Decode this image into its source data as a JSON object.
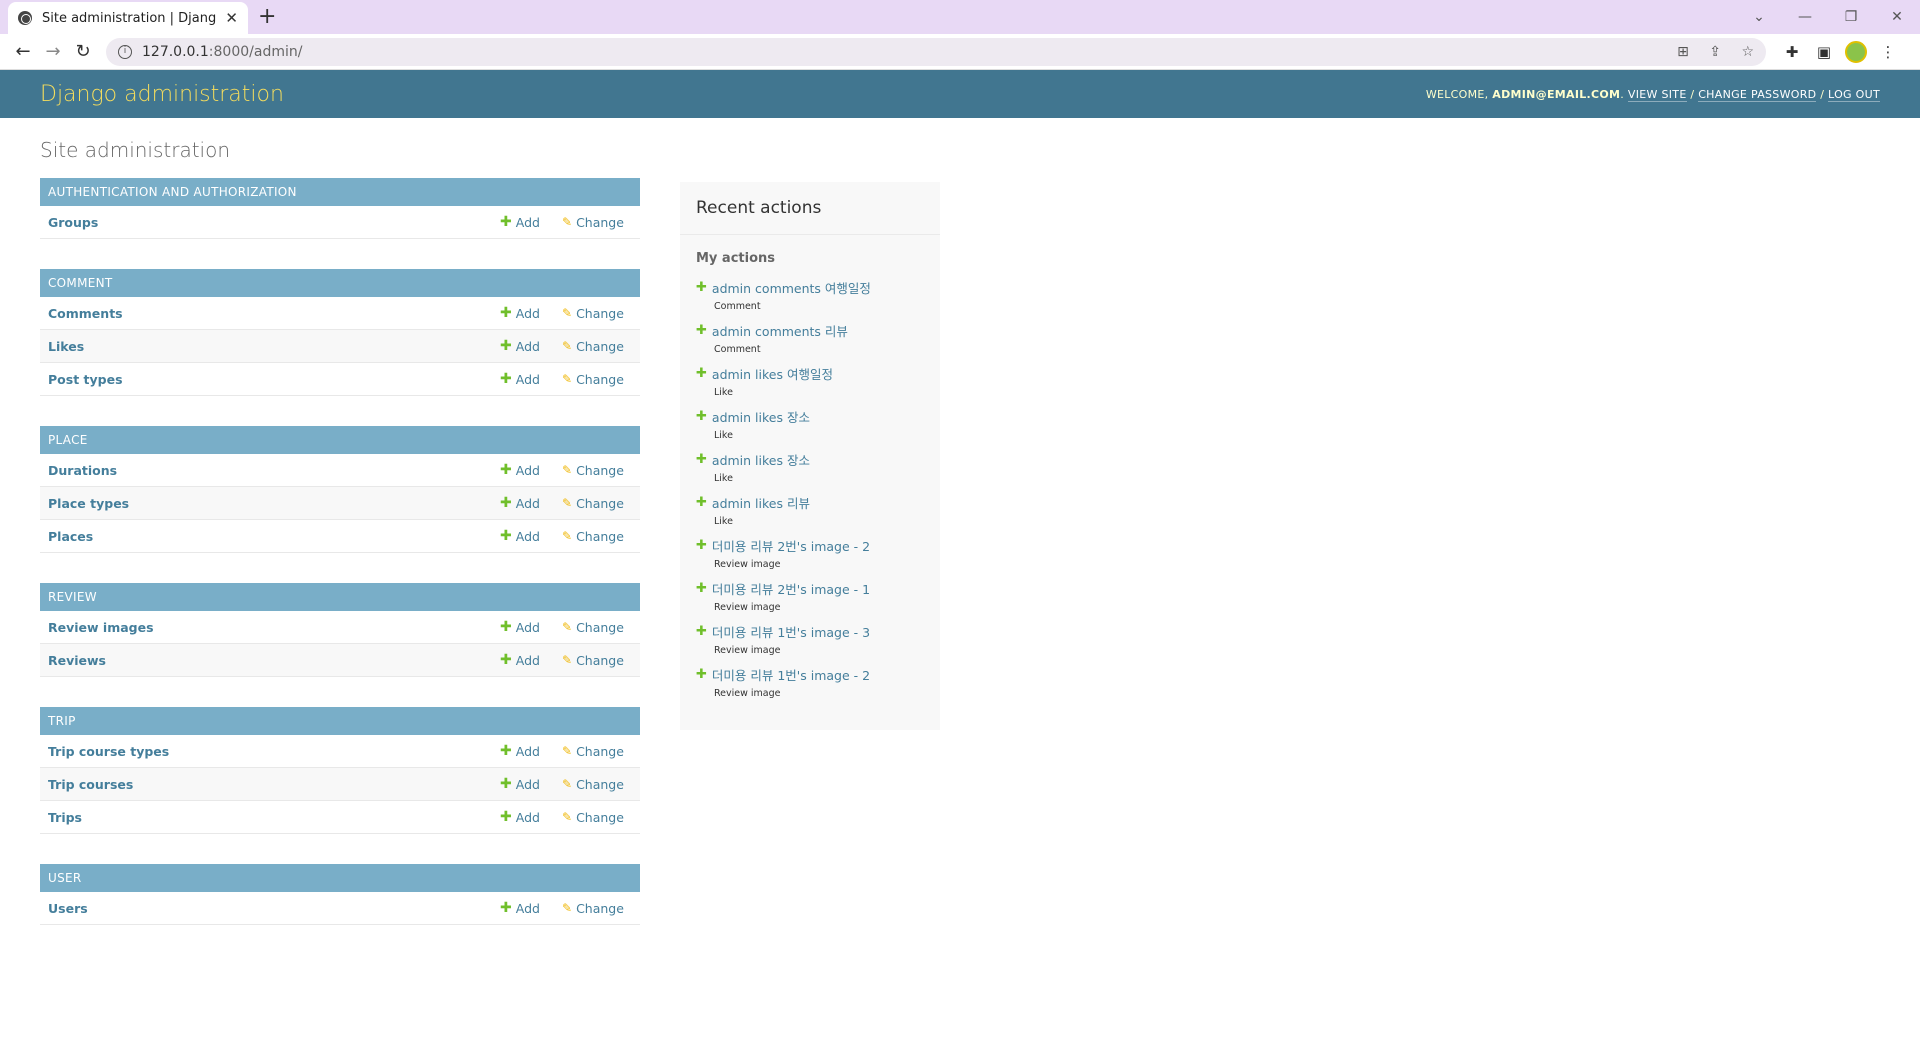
{
  "browser": {
    "tab_title": "Site administration | Django site admin",
    "url_host": "127.0.0.1",
    "url_rest": ":8000/admin/"
  },
  "header": {
    "branding": "Django administration",
    "welcome": "Welcome, ",
    "user": "admin@email.com",
    "view_site": "View site",
    "change_password": "Change password",
    "log_out": "Log out"
  },
  "page_title": "Site administration",
  "labels": {
    "add": "Add",
    "change": "Change"
  },
  "modules": [
    {
      "caption": "Authentication and Authorization",
      "models": [
        "Groups"
      ]
    },
    {
      "caption": "Comment",
      "models": [
        "Comments",
        "Likes",
        "Post types"
      ]
    },
    {
      "caption": "Place",
      "models": [
        "Durations",
        "Place types",
        "Places"
      ]
    },
    {
      "caption": "Review",
      "models": [
        "Review images",
        "Reviews"
      ]
    },
    {
      "caption": "Trip",
      "models": [
        "Trip course types",
        "Trip courses",
        "Trips"
      ]
    },
    {
      "caption": "User",
      "models": [
        "Users"
      ]
    }
  ],
  "recent_actions": {
    "title": "Recent actions",
    "subtitle": "My actions",
    "items": [
      {
        "text": "admin comments 여행일정",
        "type": "Comment"
      },
      {
        "text": "admin comments 리뷰",
        "type": "Comment"
      },
      {
        "text": "admin likes 여행일정",
        "type": "Like"
      },
      {
        "text": "admin likes 장소",
        "type": "Like"
      },
      {
        "text": "admin likes 장소",
        "type": "Like"
      },
      {
        "text": "admin likes 리뷰",
        "type": "Like"
      },
      {
        "text": "더미용 리뷰 2번's image - 2",
        "type": "Review image"
      },
      {
        "text": "더미용 리뷰 2번's image - 1",
        "type": "Review image"
      },
      {
        "text": "더미용 리뷰 1번's image - 3",
        "type": "Review image"
      },
      {
        "text": "더미용 리뷰 1번's image - 2",
        "type": "Review image"
      }
    ]
  },
  "colors": {
    "header_bg": "#417690",
    "branding": "#f5dd5d",
    "module_caption_bg": "#79aec8",
    "link": "#447e9b",
    "add_icon": "#70bf2b",
    "change_icon": "#efb80b"
  }
}
